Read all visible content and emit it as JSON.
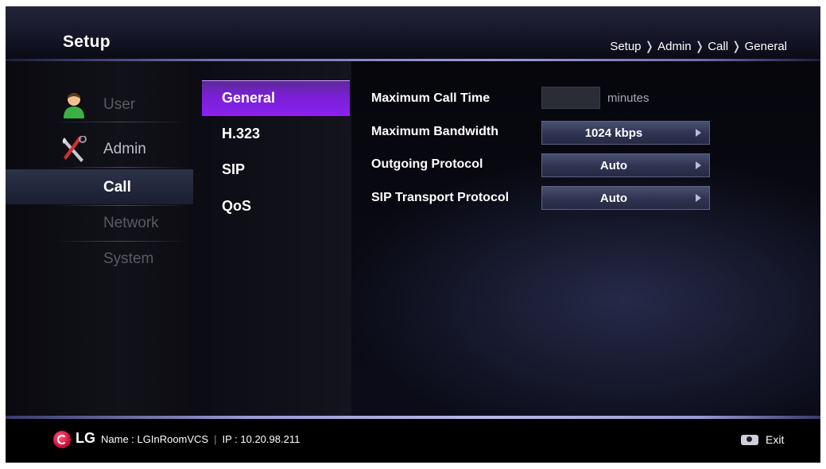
{
  "header": {
    "title": "Setup",
    "breadcrumb": [
      "Setup",
      "Admin",
      "Call",
      "General"
    ],
    "breadcrumb_separator": "❭"
  },
  "sidebar": {
    "items": [
      {
        "label": "User",
        "icon": "user-icon",
        "state": "dim"
      },
      {
        "label": "Admin",
        "icon": "tools-icon",
        "state": "bright"
      },
      {
        "label": "Call",
        "state": "selected"
      },
      {
        "label": "Network",
        "state": "dim"
      },
      {
        "label": "System",
        "state": "dim"
      }
    ]
  },
  "submenu": {
    "items": [
      {
        "label": "General",
        "selected": true
      },
      {
        "label": "H.323",
        "selected": false
      },
      {
        "label": "SIP",
        "selected": false
      },
      {
        "label": "QoS",
        "selected": false
      }
    ]
  },
  "settings": {
    "max_call_time": {
      "label": "Maximum Call Time",
      "value": "",
      "unit": "minutes"
    },
    "max_bandwidth": {
      "label": "Maximum Bandwidth",
      "value": "1024 kbps"
    },
    "outgoing_protocol": {
      "label": "Outgoing Protocol",
      "value": "Auto"
    },
    "sip_transport": {
      "label": "SIP Transport Protocol",
      "value": "Auto"
    }
  },
  "footer": {
    "brand": "LG",
    "name_text": "Name : LGInRoomVCS",
    "divider": "|",
    "ip_text": "IP : 10.20.98.211",
    "exit_label": "Exit",
    "exit_icon": "remote-exit-icon"
  },
  "colors": {
    "accent_purple": "#8a22f0",
    "header_line": "#9c9cdc",
    "footer_line": "#b8b8ee"
  }
}
